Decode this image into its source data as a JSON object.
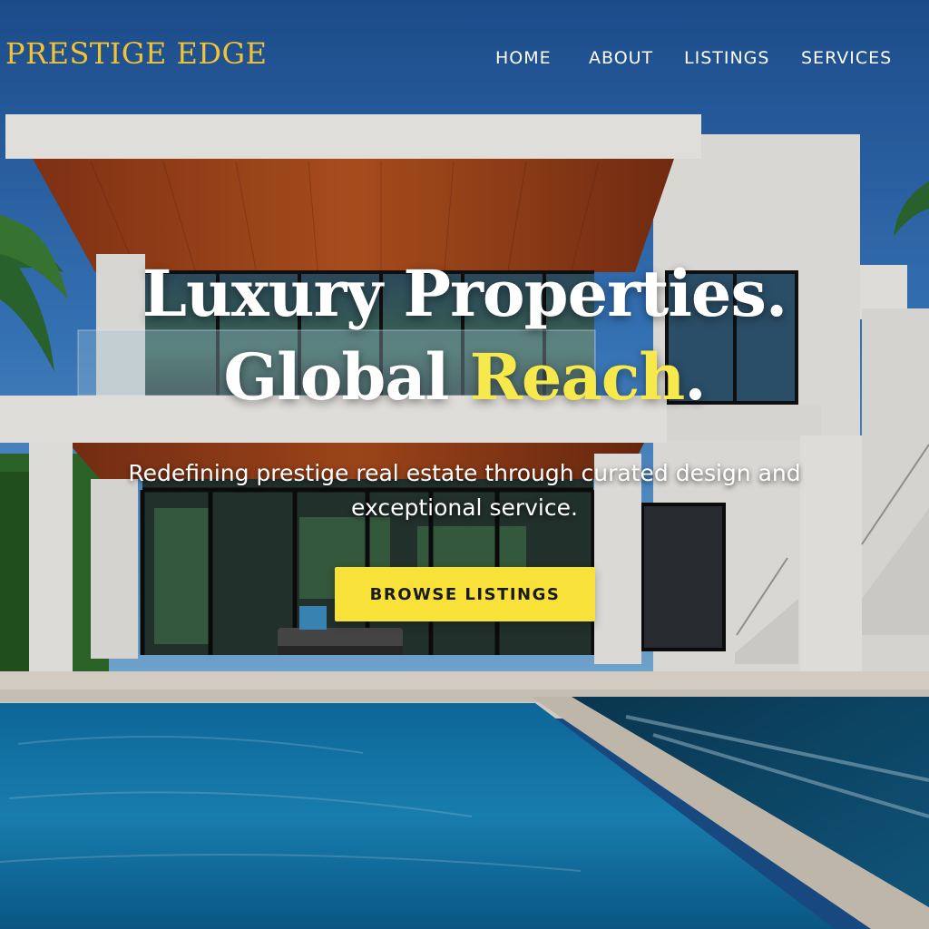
{
  "brand": {
    "name": "PRESTIGE EDGE",
    "color": "#f2c434"
  },
  "nav": {
    "items": [
      {
        "label": "HOME"
      },
      {
        "label": "ABOUT"
      },
      {
        "label": "LISTINGS"
      },
      {
        "label": "SERVICES"
      }
    ]
  },
  "hero": {
    "headline_line1": "Luxury Properties.",
    "headline_line2_prefix": "Global ",
    "headline_line2_accent": "Reach",
    "headline_line2_suffix": ".",
    "subheadline": "Redefining prestige real estate through curated design and exceptional service.",
    "cta_label": "BROWSE LISTINGS",
    "accent_color": "#f7e84b",
    "cta_color": "#f8e138",
    "background_image": "modern-villa-with-pool"
  }
}
